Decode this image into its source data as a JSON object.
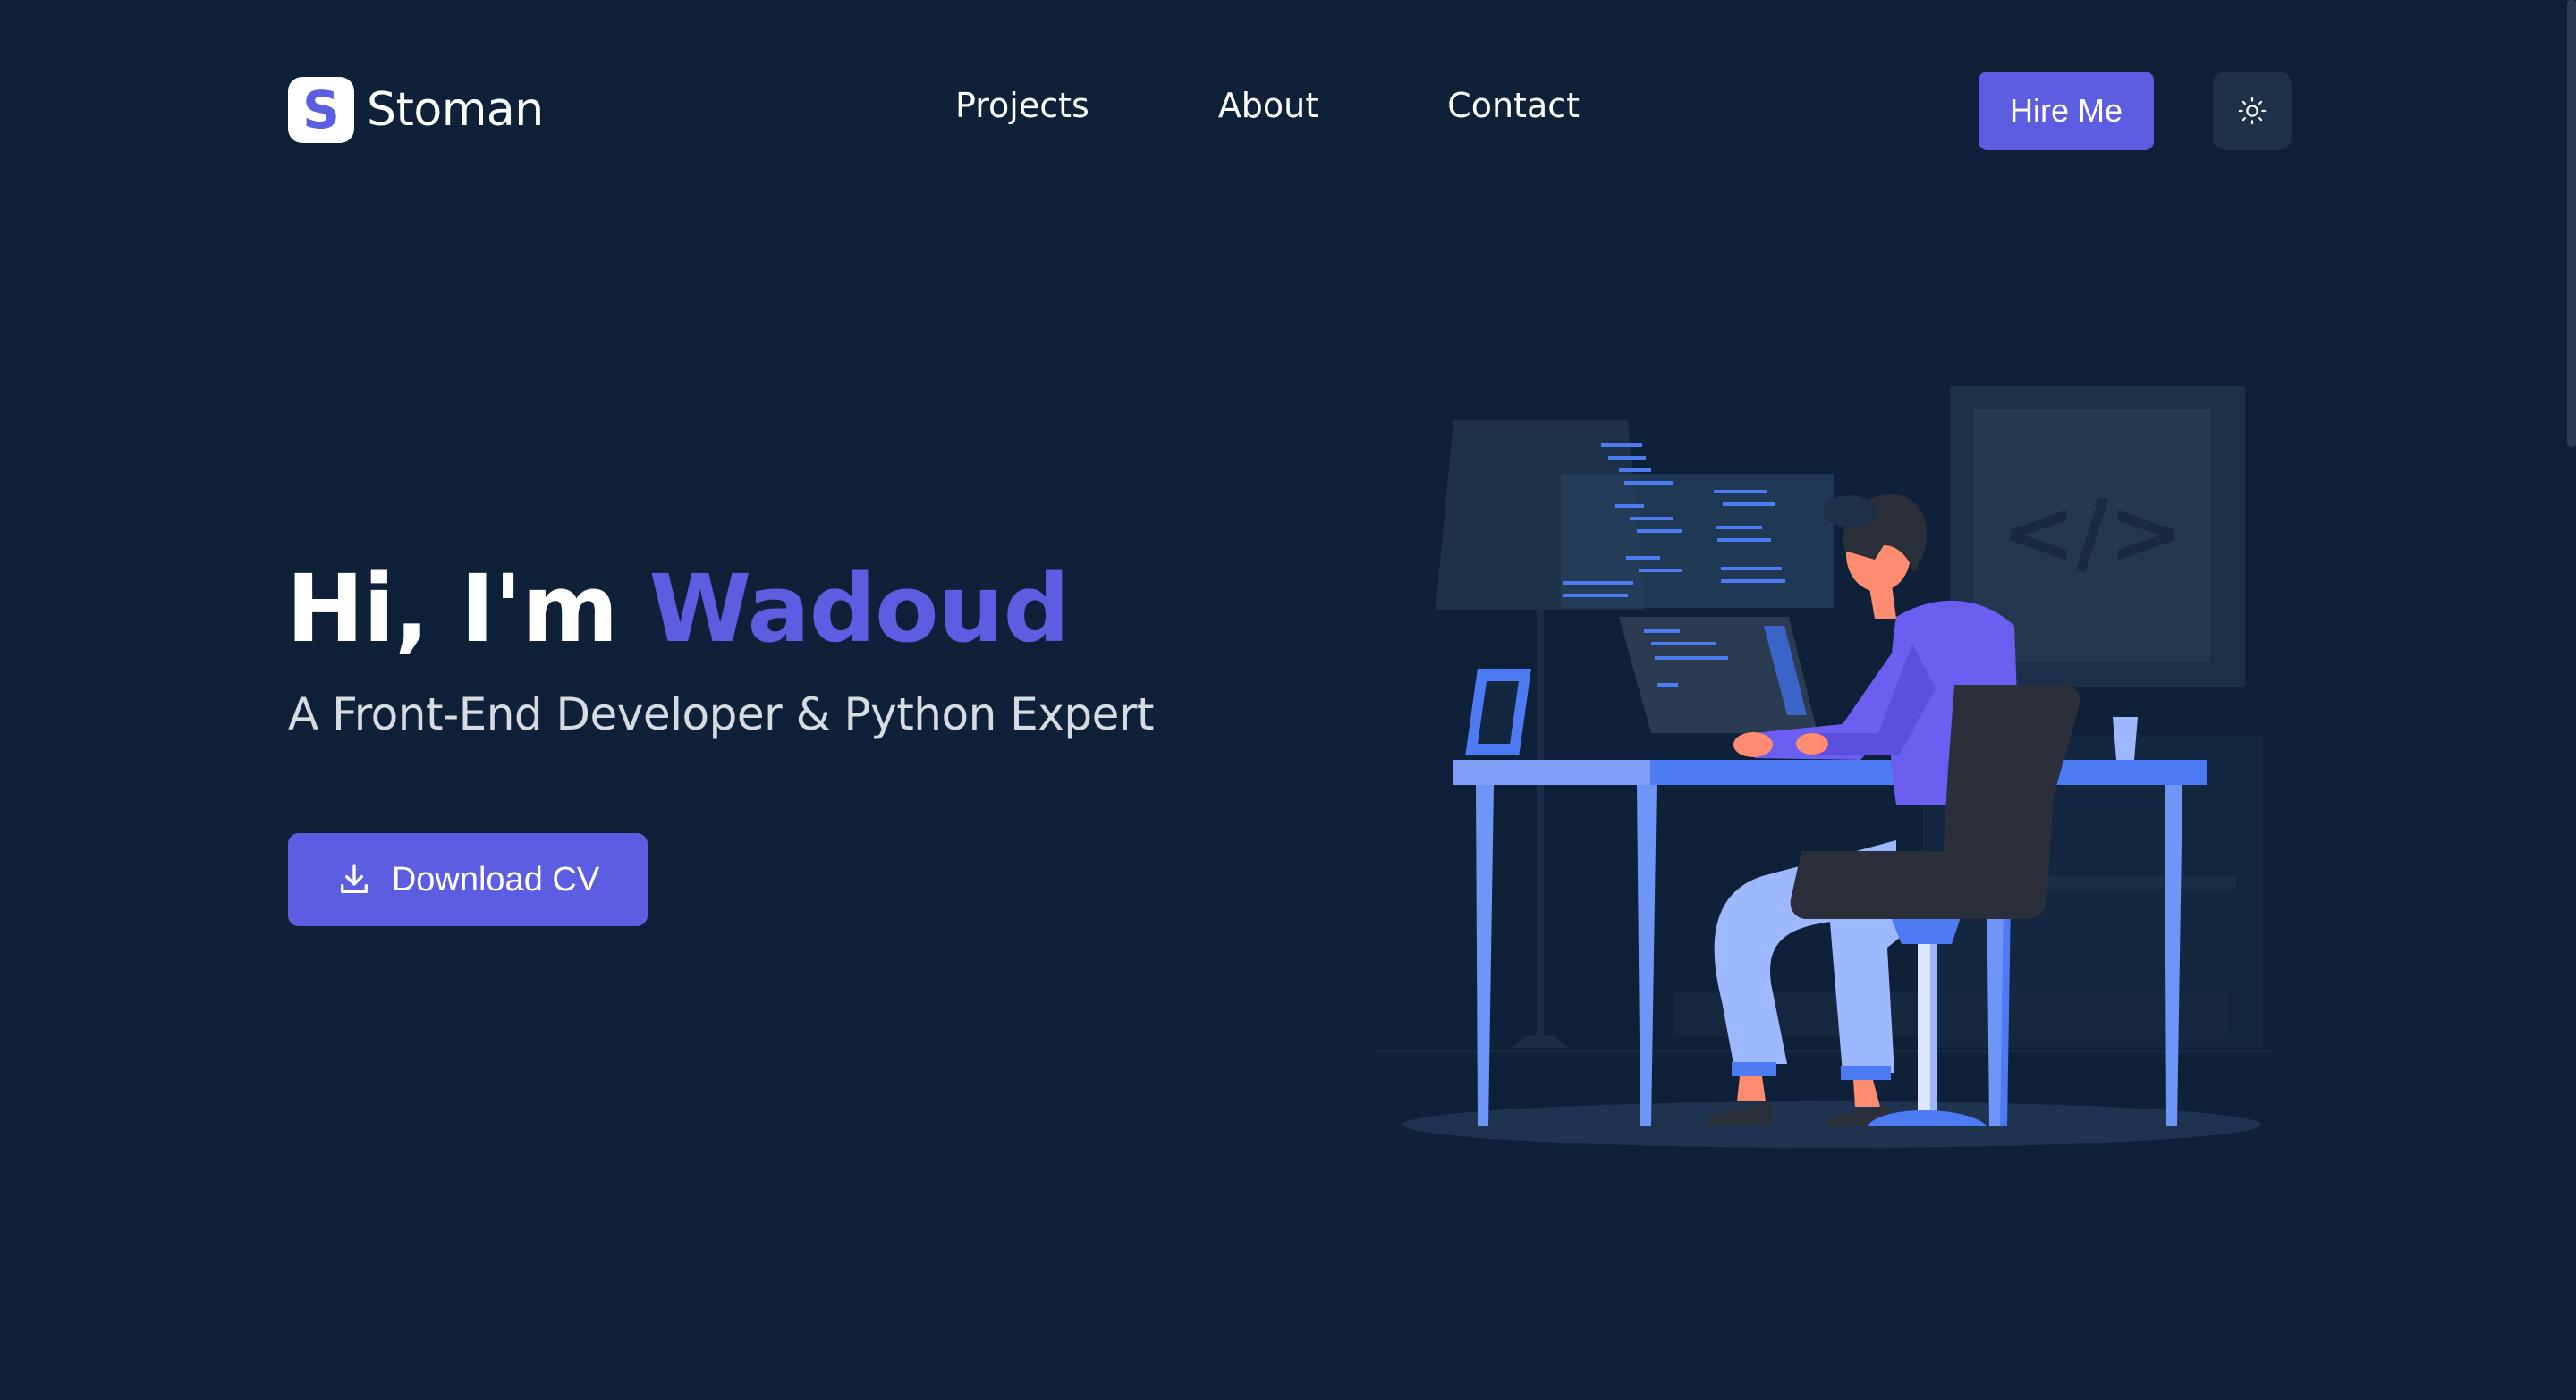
{
  "header": {
    "logo_letter": "S",
    "logo_text": "Stoman",
    "nav": [
      {
        "label": "Projects"
      },
      {
        "label": "About"
      },
      {
        "label": "Contact"
      }
    ],
    "hire_label": "Hire Me",
    "theme_icon": "sun-icon"
  },
  "hero": {
    "greeting": "Hi, I'm",
    "name": "Wadoud",
    "subtitle": "A Front-End Developer & Python Expert",
    "download_label": "Download CV",
    "download_icon": "download-icon"
  },
  "illustration": {
    "code_symbol": "</>"
  },
  "colors": {
    "background": "#0f2138",
    "accent": "#5b5ee0",
    "desk": "#4d7bf3",
    "chair": "#2a2f3a"
  }
}
